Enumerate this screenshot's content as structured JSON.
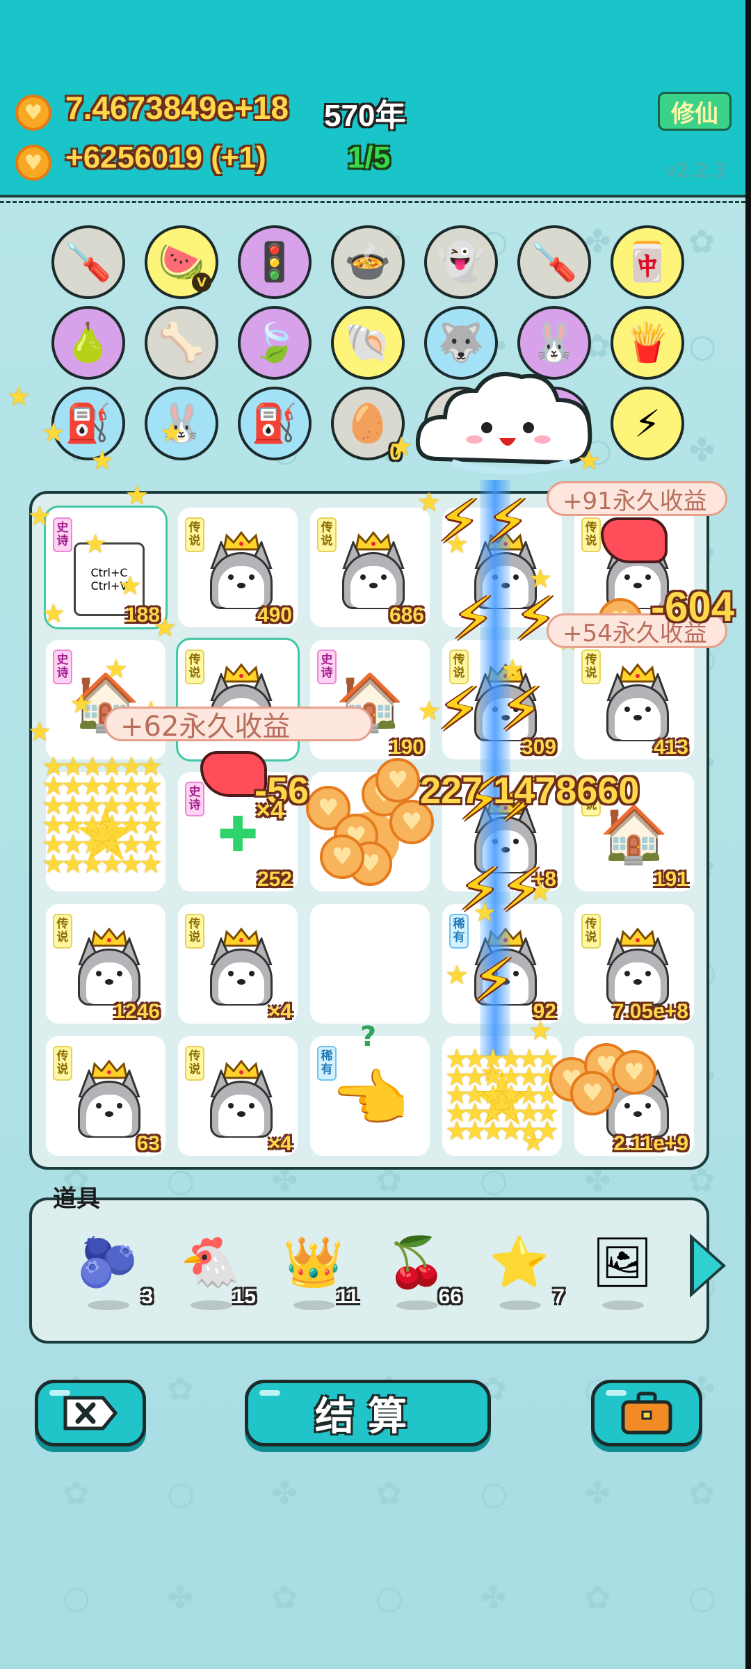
{
  "header": {
    "coins_total": "7.4673849e+18",
    "years": "570年",
    "income": "+6256019 (+1)",
    "progress": "1/5",
    "xiuxian_button": "修仙",
    "version": "v2.2.3",
    "coin_icon": "heart-coin-icon"
  },
  "shelf": {
    "rows": [
      [
        {
          "icon": "screwdriver-icon",
          "glyph": "🪛",
          "bg": "gray"
        },
        {
          "icon": "fruit-basket-icon",
          "glyph": "🍉",
          "bg": "yellow",
          "badge": "V"
        },
        {
          "icon": "traffic-light-icon",
          "glyph": "🚦",
          "bg": "purple"
        },
        {
          "icon": "duck-pot-icon",
          "glyph": "🍲",
          "bg": "gray"
        },
        {
          "icon": "ghost-icon",
          "glyph": "👻",
          "bg": "gray"
        },
        {
          "icon": "screwdriver-icon",
          "glyph": "🪛",
          "bg": "gray"
        },
        {
          "icon": "tiles-icon",
          "glyph": "🀄",
          "bg": "yellow"
        }
      ],
      [
        {
          "icon": "pomelo-icon",
          "glyph": "🍐",
          "bg": "purple"
        },
        {
          "icon": "dog-bowl-icon",
          "glyph": "🦴",
          "bg": "gray"
        },
        {
          "icon": "leaf-icon",
          "glyph": "🍃",
          "bg": "purple"
        },
        {
          "icon": "shell-icon",
          "glyph": "🐚",
          "bg": "yellow"
        },
        {
          "icon": "husky-icon",
          "glyph": "🐺",
          "bg": "blue"
        },
        {
          "icon": "rabbit-icon",
          "glyph": "🐰",
          "bg": "purple"
        },
        {
          "icon": "fries-icon",
          "glyph": "🍟",
          "bg": "yellow"
        }
      ],
      [
        {
          "icon": "pump-icon",
          "glyph": "⛽",
          "bg": "blue"
        },
        {
          "icon": "rabbit-icon",
          "glyph": "🐰",
          "bg": "blue"
        },
        {
          "icon": "pump-icon",
          "glyph": "⛽",
          "bg": "blue"
        },
        {
          "icon": "egg-tray-icon",
          "glyph": "🥚",
          "bg": "gray"
        },
        {
          "icon": "cloud-covered-icon",
          "glyph": "",
          "bg": "gray"
        },
        {
          "icon": "cloud-covered-icon",
          "glyph": "",
          "bg": "purple"
        },
        {
          "icon": "lightning-icon",
          "glyph": "⚡",
          "bg": "yellow"
        }
      ]
    ],
    "pump_count": "0"
  },
  "board": {
    "rows": [
      [
        {
          "tag": "史诗",
          "tag_type": "shi",
          "item": "ctrl-cv-icon",
          "count": "188",
          "highlight": true,
          "label": "Ctrl+C\nCtrl+V"
        },
        {
          "tag": "传说",
          "tag_type": "chuan",
          "item": "husky",
          "count": "490"
        },
        {
          "tag": "传说",
          "tag_type": "chuan",
          "item": "husky",
          "count": "686"
        },
        {
          "tag": "",
          "tag_type": "",
          "item": "husky",
          "count": ""
        },
        {
          "tag": "传说",
          "tag_type": "chuan",
          "item": "husky",
          "count": ""
        }
      ],
      [
        {
          "tag": "史诗",
          "tag_type": "shi",
          "item": "rabbit-house",
          "count": ""
        },
        {
          "tag": "传说",
          "tag_type": "chuan",
          "item": "husky",
          "count": "",
          "highlight": true
        },
        {
          "tag": "史诗",
          "tag_type": "shi",
          "item": "rabbit-house",
          "count": "190"
        },
        {
          "tag": "传说",
          "tag_type": "chuan",
          "item": "husky",
          "count": "309"
        },
        {
          "tag": "传说",
          "tag_type": "chuan",
          "item": "husky",
          "count": "413"
        }
      ],
      [
        {
          "tag": "",
          "tag_type": "",
          "item": "stars",
          "count": ""
        },
        {
          "tag": "史诗",
          "tag_type": "shi",
          "item": "liver",
          "count": "252"
        },
        {
          "tag": "",
          "tag_type": "",
          "item": "coins",
          "count": ""
        },
        {
          "tag": "",
          "tag_type": "",
          "item": "husky",
          "count": "+8"
        },
        {
          "tag": "传说",
          "tag_type": "chuan",
          "item": "rabbit-house",
          "count": "191"
        }
      ],
      [
        {
          "tag": "传说",
          "tag_type": "chuan",
          "item": "husky",
          "count": "1246"
        },
        {
          "tag": "传说",
          "tag_type": "chuan",
          "item": "husky",
          "count": "×4"
        },
        {
          "tag": "",
          "tag_type": "",
          "item": "empty",
          "count": ""
        },
        {
          "tag": "稀有",
          "tag_type": "xi",
          "item": "husky",
          "count": "92"
        },
        {
          "tag": "传说",
          "tag_type": "chuan",
          "item": "husky",
          "count": "7.05e+8"
        }
      ],
      [
        {
          "tag": "传说",
          "tag_type": "chuan",
          "item": "husky",
          "count": "63"
        },
        {
          "tag": "传说",
          "tag_type": "chuan",
          "item": "husky",
          "count": "×4"
        },
        {
          "tag": "稀有",
          "tag_type": "xi",
          "item": "pointing-hand",
          "count": ""
        },
        {
          "tag": "",
          "tag_type": "",
          "item": "stars",
          "count": ""
        },
        {
          "tag": "",
          "tag_type": "",
          "item": "husky",
          "count": "2.11e+9"
        }
      ]
    ]
  },
  "effects": {
    "bonus_1": "+91永久收益",
    "bonus_2": "+54永久收益",
    "bonus_3": "+62永久收益",
    "big_number": "-604",
    "coins_number": "227 1478660",
    "multiplier": "×4",
    "partial": "-56",
    "question": "?"
  },
  "props": {
    "title": "道具",
    "items": [
      {
        "icon": "blueberry-icon",
        "glyph": "🫐",
        "count": "3"
      },
      {
        "icon": "white-chicken-icon",
        "glyph": "🐔",
        "count": "15"
      },
      {
        "icon": "crown-icon",
        "glyph": "👑",
        "count": "11"
      },
      {
        "icon": "lychee-icon",
        "glyph": "🍒",
        "count": "66"
      },
      {
        "icon": "star-icon",
        "glyph": "⭐",
        "count": "7"
      },
      {
        "icon": "frame-icon",
        "glyph": "🖼",
        "count": ""
      }
    ]
  },
  "buttons": {
    "delete_icon": "delete-icon",
    "settle_label": "结算",
    "bag_icon": "briefcase-icon"
  },
  "colors": {
    "top_bar": "#19c5c8",
    "accent_gold": "#ffd74a",
    "board_bg": "#dceeed",
    "button_teal": "#21c5c9"
  }
}
